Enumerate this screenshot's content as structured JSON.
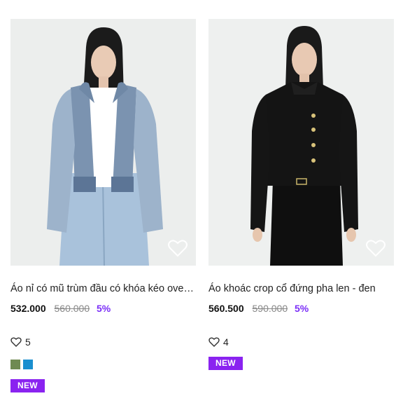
{
  "products": [
    {
      "title": "Áo nỉ có mũ trùm đầu có khóa kéo overd...",
      "price": "532.000",
      "old_price": "560.000",
      "discount": "5%",
      "likes": "5",
      "swatches": [
        "#6f8a52",
        "#1a8fcf"
      ],
      "badge": "NEW"
    },
    {
      "title": "Áo khoác crop cổ đứng pha len - đen",
      "price": "560.500",
      "old_price": "590.000",
      "discount": "5%",
      "likes": "4",
      "badge": "NEW"
    }
  ]
}
